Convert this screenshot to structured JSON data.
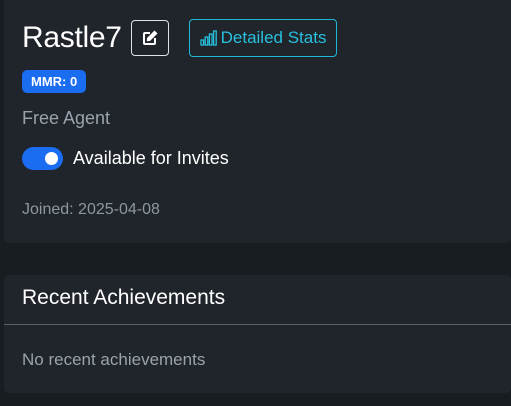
{
  "profile": {
    "username": "Rastle7",
    "edit_icon": "pencil-square-icon",
    "stats_button": {
      "icon": "bar-chart-icon",
      "label": "Detailed Stats"
    },
    "mmr_badge": "MMR: 0",
    "agent_status": "Free Agent",
    "invites": {
      "label": "Available for Invites",
      "enabled": true
    },
    "joined": "Joined: 2025-04-08"
  },
  "achievements": {
    "title": "Recent Achievements",
    "empty_text": "No recent achievements"
  },
  "colors": {
    "accent_blue": "#1a6cf0",
    "accent_cyan": "#27c0de",
    "card_bg": "#20252b",
    "page_bg": "#181d22"
  }
}
